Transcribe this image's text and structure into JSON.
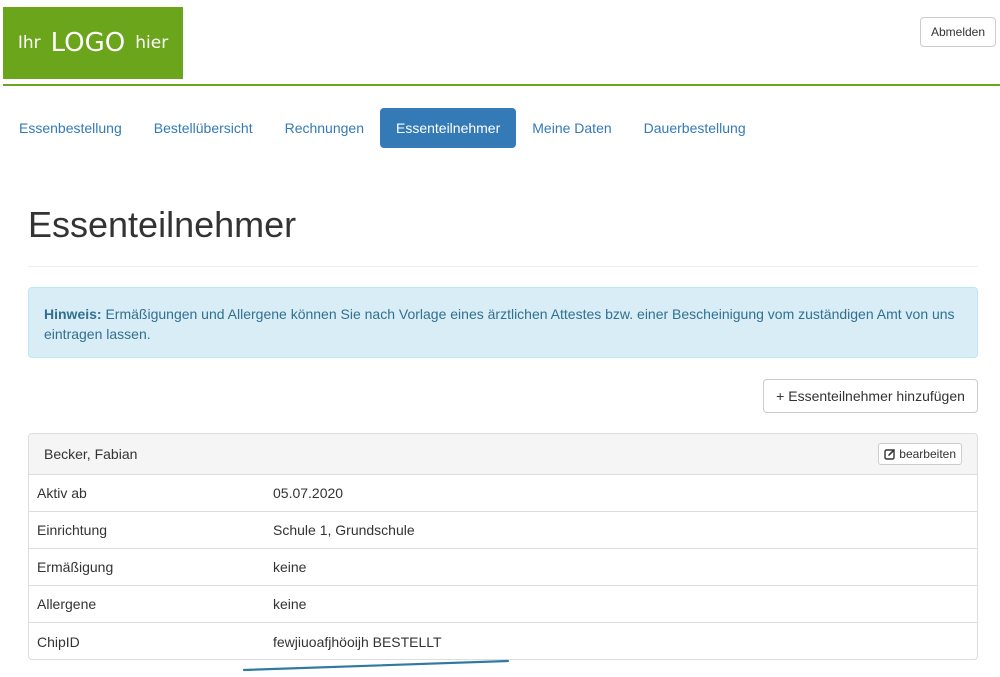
{
  "header": {
    "logo": {
      "prefix": "Ihr",
      "main": "LOGO",
      "suffix": "hier"
    },
    "logout_label": "Abmelden",
    "brand_color": "#6aa51b"
  },
  "nav": {
    "items": [
      {
        "label": "Essenbestellung",
        "active": false
      },
      {
        "label": "Bestellübersicht",
        "active": false
      },
      {
        "label": "Rechnungen",
        "active": false
      },
      {
        "label": "Essenteilnehmer",
        "active": true
      },
      {
        "label": "Meine Daten",
        "active": false
      },
      {
        "label": "Dauerbestellung",
        "active": false
      }
    ],
    "active_color": "#337ab7"
  },
  "page": {
    "title": "Essenteilnehmer"
  },
  "alert": {
    "strong": "Hinweis:",
    "text": "Ermäßigungen und Allergene können Sie nach Vorlage eines ärztlichen Attestes bzw. einer Bescheinigung vom zuständigen Amt von uns eintragen lassen."
  },
  "add_button": {
    "icon": "plus-icon",
    "label": "Essenteilnehmer hinzufügen"
  },
  "participant": {
    "name": "Becker, Fabian",
    "edit_label": "bearbeiten",
    "edit_icon": "edit-icon",
    "rows": [
      {
        "label": "Aktiv ab",
        "value": "05.07.2020"
      },
      {
        "label": "Einrichtung",
        "value": "Schule 1, Grundschule"
      },
      {
        "label": "Ermäßigung",
        "value": "keine"
      },
      {
        "label": "Allergene",
        "value": "keine"
      },
      {
        "label": "ChipID",
        "value": "fewjiuoafjhöoijh BESTELLT"
      }
    ]
  }
}
